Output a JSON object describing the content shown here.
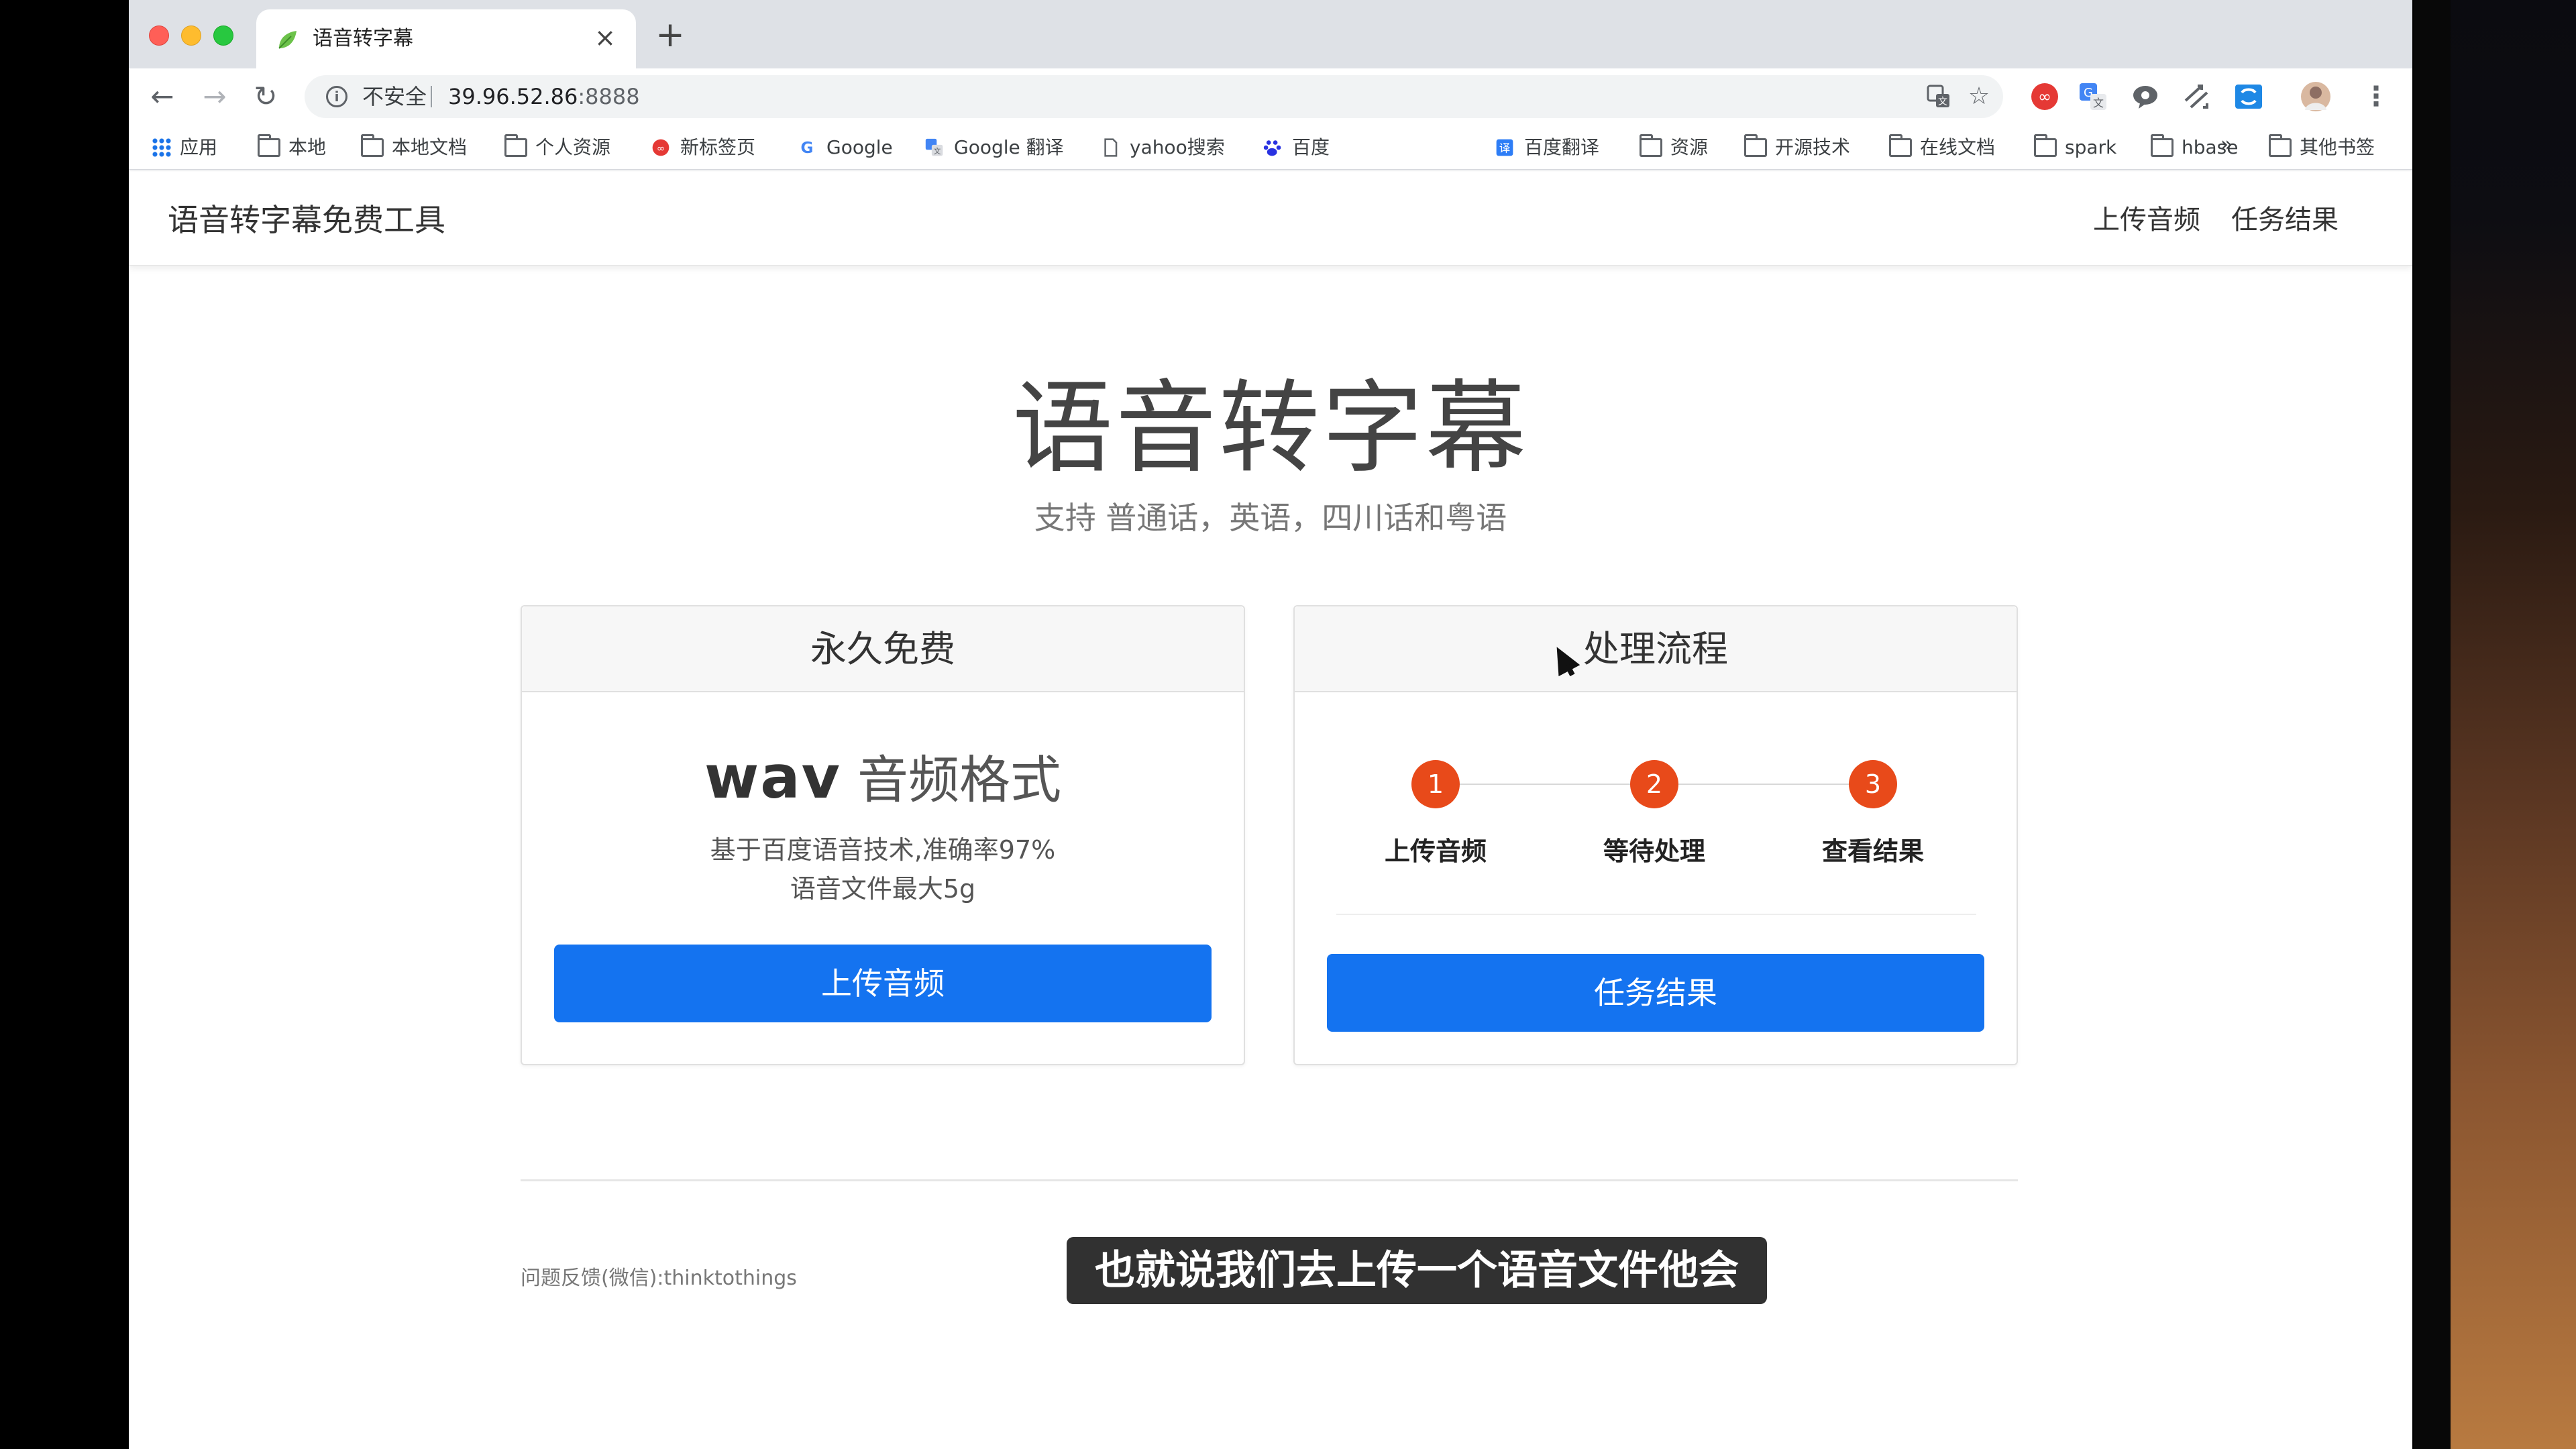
{
  "browser": {
    "tab_title": "语音转字幕",
    "tab_close": "×",
    "new_tab": "+",
    "security_label": "不安全",
    "url_host": "39.96.52.86",
    "url_port": ":8888",
    "bookmarks": [
      {
        "label": "应用",
        "icon": "apps-grid-icon"
      },
      {
        "label": "本地",
        "icon": "folder-icon"
      },
      {
        "label": "本地文档",
        "icon": "folder-icon"
      },
      {
        "label": "个人资源",
        "icon": "folder-icon"
      },
      {
        "label": "新标签页",
        "icon": "infinity-icon"
      },
      {
        "label": "Google",
        "icon": "google-icon"
      },
      {
        "label": "Google 翻译",
        "icon": "translate-icon"
      },
      {
        "label": "yahoo搜索",
        "icon": "page-icon"
      },
      {
        "label": "百度",
        "icon": "baidu-paw-icon"
      },
      {
        "label": "百度翻译",
        "icon": "baidu-translate-icon"
      },
      {
        "label": "资源",
        "icon": "folder-icon"
      },
      {
        "label": "开源技术",
        "icon": "folder-icon"
      },
      {
        "label": "在线文档",
        "icon": "folder-icon"
      },
      {
        "label": "spark",
        "icon": "folder-icon"
      },
      {
        "label": "hbase",
        "icon": "folder-icon"
      }
    ],
    "bookmarks_overflow": "»",
    "other_bookmarks": "其他书签"
  },
  "navbar": {
    "brand": "语音转字幕免费工具",
    "links": [
      "上传音频",
      "任务结果"
    ]
  },
  "hero": {
    "title": "语音转字幕",
    "subtitle": "支持 普通话，英语，四川话和粤语"
  },
  "card_free": {
    "header": "永久免费",
    "format_big": "wav",
    "format_small": "音频格式",
    "desc_line1": "基于百度语音技术,准确率97%",
    "desc_line2": "语音文件最大5g",
    "button": "上传音频"
  },
  "card_process": {
    "header": "处理流程",
    "steps": [
      {
        "num": "1",
        "label": "上传音频"
      },
      {
        "num": "2",
        "label": "等待处理"
      },
      {
        "num": "3",
        "label": "查看结果"
      }
    ],
    "button": "任务结果"
  },
  "footer": {
    "feedback": "问题反馈(微信):thinktothings"
  },
  "video_subtitle": "也就说我们去上传一个语音文件他会",
  "colors": {
    "primary_button": "#1473f0",
    "step_dot": "#e84a1a"
  }
}
